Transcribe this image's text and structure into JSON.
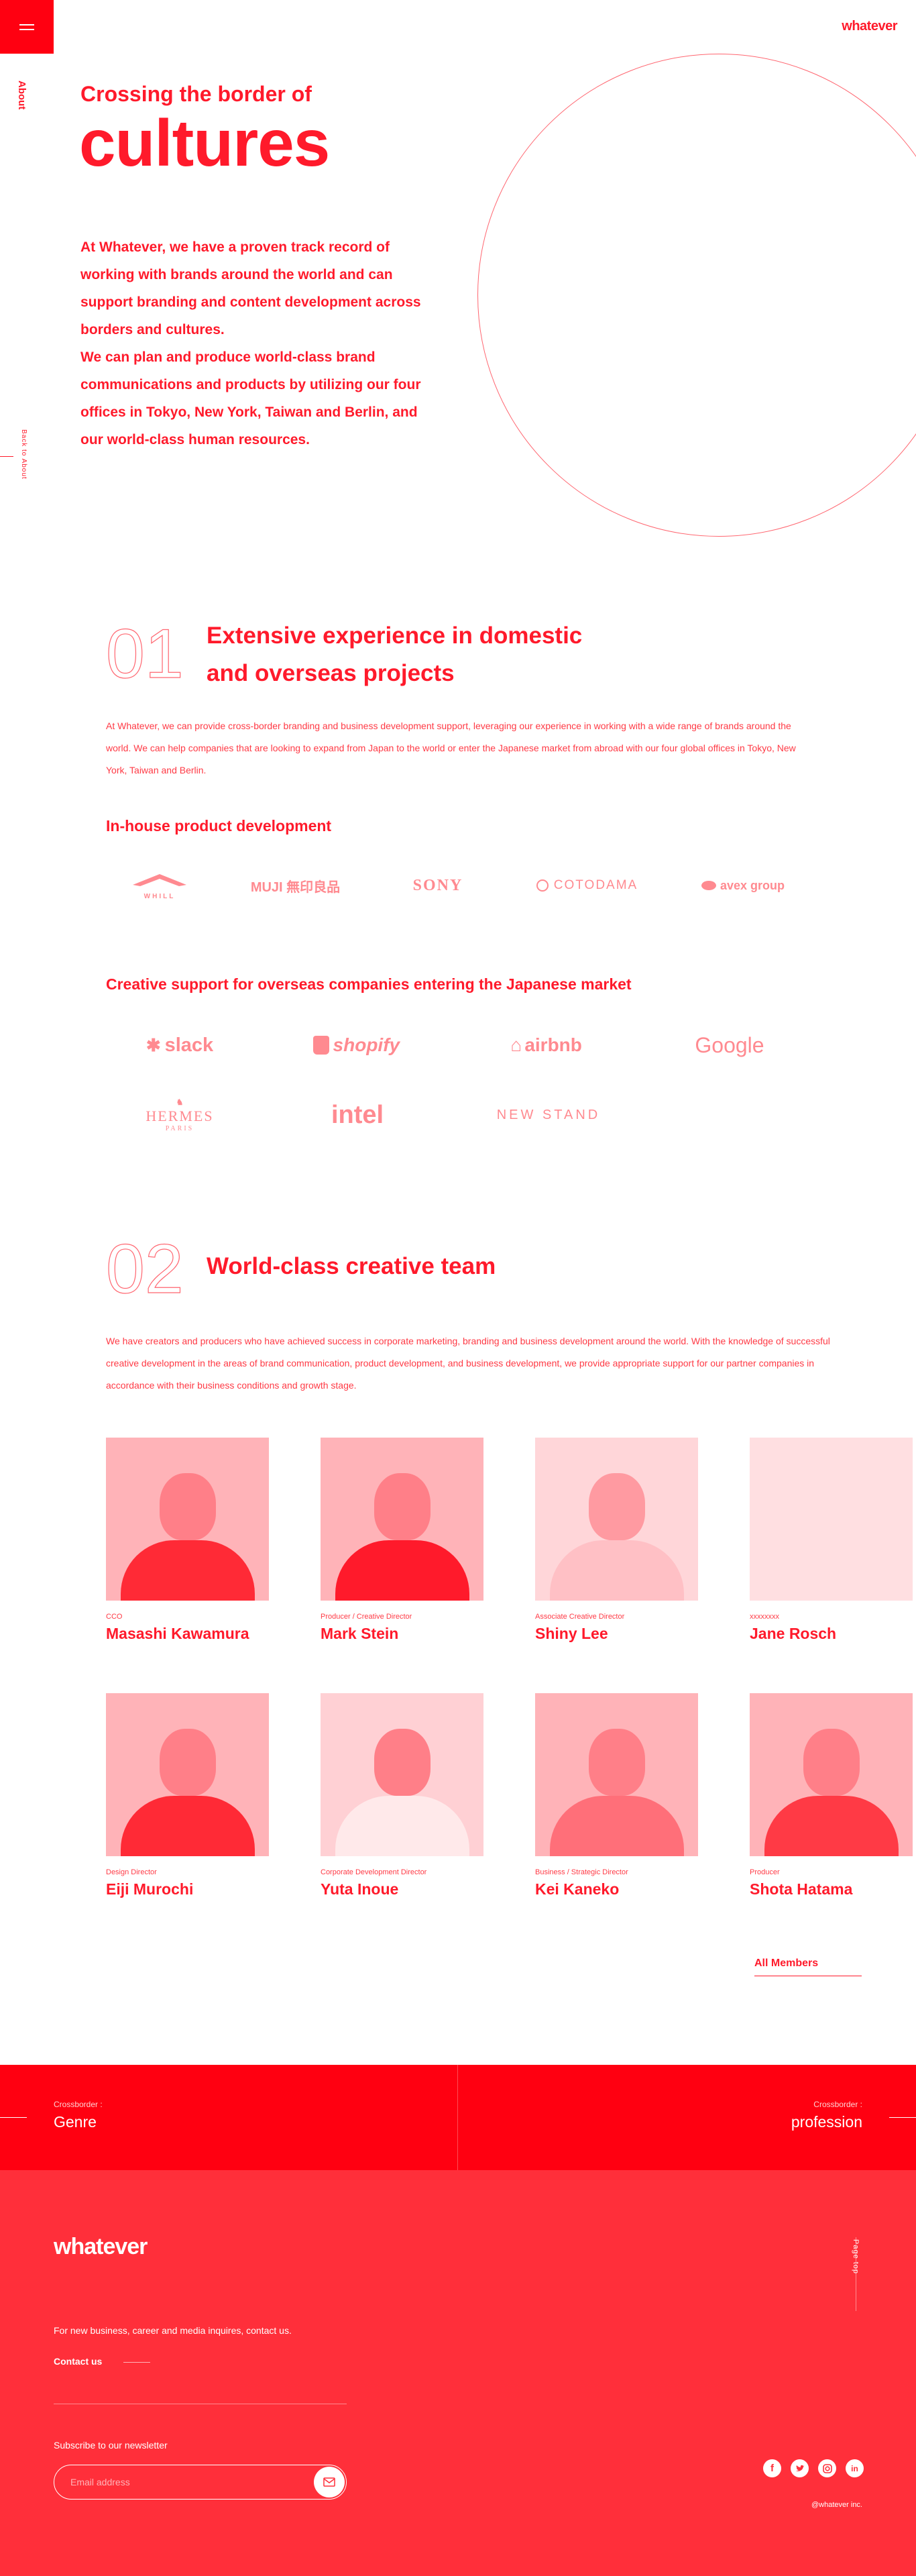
{
  "header": {
    "logo": "whatever",
    "menu_icon": "hamburger-icon"
  },
  "side": {
    "about": "About",
    "back": "Back to About"
  },
  "hero": {
    "subtitle": "Crossing the border of",
    "title": "cultures",
    "paragraph1": "At Whatever, we have a proven track record of working with brands around the world and can support branding and content development across borders and cultures.",
    "paragraph2": "We can plan and produce world-class brand communications and products by utilizing our four offices in Tokyo, New York, Taiwan and Berlin, and our world-class human resources."
  },
  "section1": {
    "number": "01",
    "title_line1": "Extensive experience in domestic",
    "title_line2": "and overseas projects",
    "body": "At Whatever, we can provide cross-border branding and business development support, leveraging our experience in working with a wide range of brands around the world. We can help companies that are looking to expand from Japan to the world or enter the Japanese market from abroad with our four global offices in Tokyo, New York, Taiwan and Berlin.",
    "inhouse_title": "In-house product development",
    "inhouse_brands": [
      "WHILL",
      "MUJI 無印良品",
      "SONY",
      "COTODAMA",
      "avex group"
    ],
    "creative_title": "Creative support for overseas companies entering the Japanese market",
    "creative_brands_row1": [
      "slack",
      "shopify",
      "airbnb",
      "Google"
    ],
    "creative_brands_row2": [
      "HERMES",
      "intel",
      "NEW STAND"
    ],
    "hermes_sub": "PARIS"
  },
  "section2": {
    "number": "02",
    "title": "World-class creative team",
    "body": "We have creators and producers who have achieved success in corporate marketing, branding and business development around the world. With the knowledge of successful creative development in the areas of brand communication, product development, and business development, we provide appropriate support for our partner companies in accordance with their business conditions and growth stage.",
    "members": [
      {
        "role": "CCO",
        "name": "Masashi Kawamura"
      },
      {
        "role": "Producer / Creative Director",
        "name": "Mark Stein"
      },
      {
        "role": "Associate Creative Director",
        "name": "Shiny Lee"
      },
      {
        "role": "xxxxxxxx",
        "name": "Jane Rosch"
      },
      {
        "role": "Design Director",
        "name": "Eiji Murochi"
      },
      {
        "role": "Corporate Development Director",
        "name": "Yuta Inoue"
      },
      {
        "role": "Business / Strategic Director",
        "name": "Kei Kaneko"
      },
      {
        "role": "Producer",
        "name": "Shota Hatama"
      }
    ],
    "all_members": "All Members"
  },
  "crossborder": {
    "left_small": "Crossborder :",
    "left_big": "Genre",
    "right_small": "Crossborder :",
    "right_big": "profession"
  },
  "footer": {
    "logo": "whatever",
    "inquiry": "For new business, career and media inquires, contact us.",
    "contact": "Contact us",
    "newsletter": "Subscribe to our newsletter",
    "email_placeholder": "Email address",
    "page_top": "Page top",
    "copyright": "@whatever inc.",
    "social_icons": [
      "facebook-icon",
      "twitter-icon",
      "instagram-icon",
      "linkedin-icon"
    ]
  },
  "colors": {
    "accent": "#ff1a2b",
    "band": "#ff0011",
    "footer": "#ff2f3a"
  }
}
